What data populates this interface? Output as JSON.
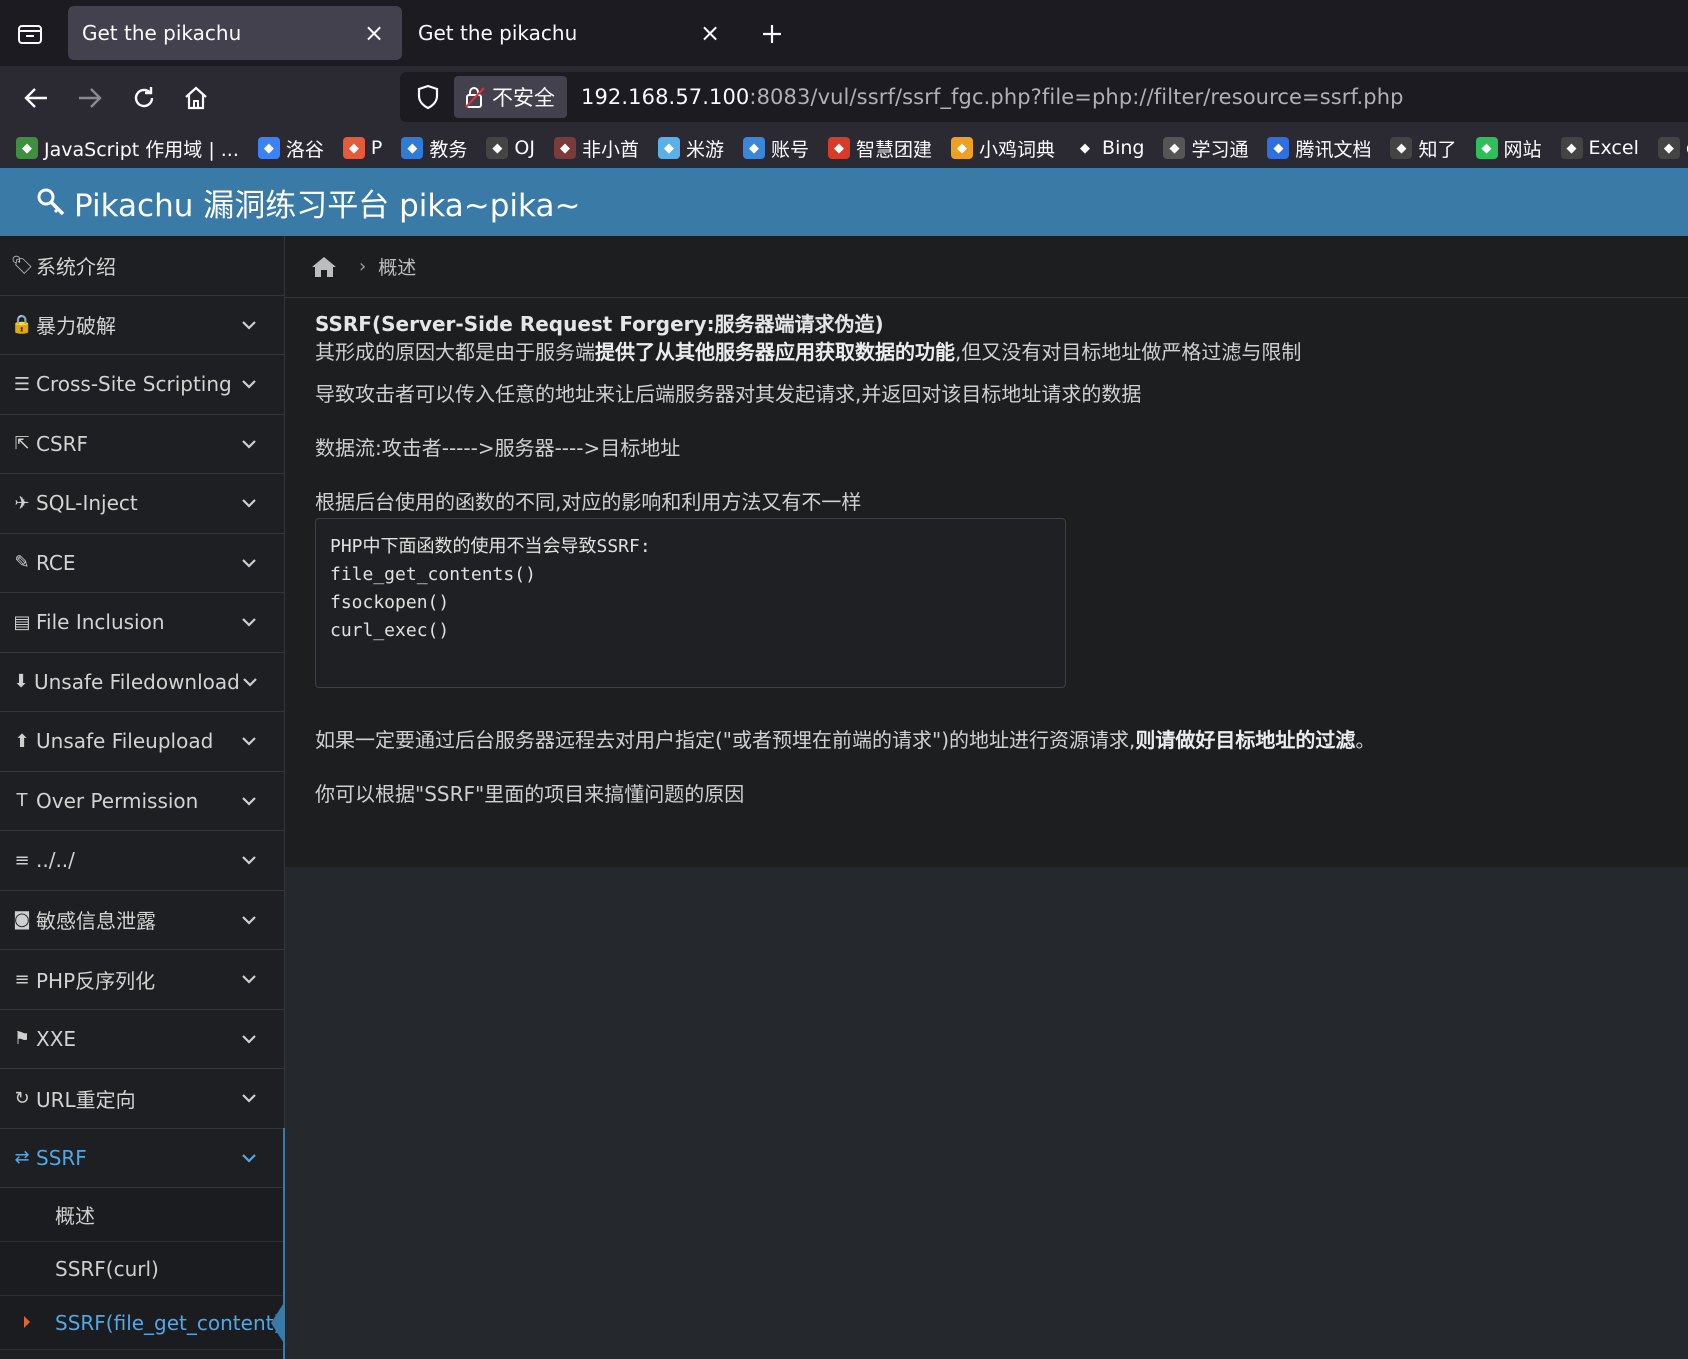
{
  "browser": {
    "tabs": [
      {
        "title": "Get the pikachu",
        "active": true
      },
      {
        "title": "Get the pikachu",
        "active": false
      }
    ],
    "insecure_label": "不安全",
    "url_host": "192.168.57.100",
    "url_rest": ":8083/vul/ssrf/ssrf_fgc.php?file=php://filter/resource=ssrf.php",
    "bookmarks": [
      {
        "label": "JavaScript 作用域 | ...",
        "icon": "js-icon",
        "color": "#3f8f3f"
      },
      {
        "label": "洛谷",
        "icon": "luogu-icon",
        "color": "#3b82f6"
      },
      {
        "label": "P",
        "icon": "p-icon",
        "color": "#e45a3b"
      },
      {
        "label": "教务",
        "icon": "edu-icon",
        "color": "#2f7bd8"
      },
      {
        "label": "OJ",
        "icon": "globe-icon",
        "color": "#444"
      },
      {
        "label": "非小酋",
        "icon": "anime-icon",
        "color": "#7a3b3b"
      },
      {
        "label": "米游",
        "icon": "miyou-icon",
        "color": "#5ab0e8"
      },
      {
        "label": "账号",
        "icon": "mi-icon",
        "color": "#3a86d8"
      },
      {
        "label": "智慧团建",
        "icon": "league-icon",
        "color": "#d83b2a"
      },
      {
        "label": "小鸡词典",
        "icon": "chick-icon",
        "color": "#f0a020"
      },
      {
        "label": "Bing",
        "icon": "search-icon",
        "color": "#2b2a33"
      },
      {
        "label": "学习通",
        "icon": "xxt-icon",
        "color": "#555"
      },
      {
        "label": "腾讯文档",
        "icon": "tencent-doc-icon",
        "color": "#2f6fe0"
      },
      {
        "label": "知了",
        "icon": "globe-icon",
        "color": "#444"
      },
      {
        "label": "网站",
        "icon": "site-icon",
        "color": "#2fbf5a"
      },
      {
        "label": "Excel",
        "icon": "excel-icon",
        "color": "#444"
      },
      {
        "label": "cha",
        "icon": "chatgpt-icon",
        "color": "#444"
      }
    ]
  },
  "header": {
    "brand": "Pikachu 漏洞练习平台 pika~pika~"
  },
  "sidebar": {
    "items": [
      {
        "label": "系统介绍",
        "icon": "tags-icon",
        "glyph": "🏷",
        "expandable": false
      },
      {
        "label": "暴力破解",
        "icon": "lock-icon",
        "glyph": "🔒",
        "expandable": true
      },
      {
        "label": "Cross-Site Scripting",
        "icon": "list-indent-icon",
        "glyph": "☰",
        "expandable": true
      },
      {
        "label": "CSRF",
        "icon": "share-icon",
        "glyph": "⇱",
        "expandable": true
      },
      {
        "label": "SQL-Inject",
        "icon": "plane-icon",
        "glyph": "✈",
        "expandable": true
      },
      {
        "label": "RCE",
        "icon": "pencil-icon",
        "glyph": "✎",
        "expandable": true
      },
      {
        "label": "File Inclusion",
        "icon": "file-icon",
        "glyph": "▤",
        "expandable": true
      },
      {
        "label": "Unsafe Filedownload",
        "icon": "download-circle-icon",
        "glyph": "⬇",
        "expandable": true
      },
      {
        "label": "Unsafe Fileupload",
        "icon": "upload-circle-icon",
        "glyph": "⬆",
        "expandable": true
      },
      {
        "label": "Over Permission",
        "icon": "text-height-icon",
        "glyph": "T",
        "expandable": true
      },
      {
        "label": "../../",
        "icon": "align-left-icon",
        "glyph": "≡",
        "expandable": true
      },
      {
        "label": "敏感信息泄露",
        "icon": "camera-icon",
        "glyph": "◙",
        "expandable": true
      },
      {
        "label": "PHP反序列化",
        "icon": "align-left-icon",
        "glyph": "≡",
        "expandable": true
      },
      {
        "label": "XXE",
        "icon": "flag-icon",
        "glyph": "⚑",
        "expandable": true
      },
      {
        "label": "URL重定向",
        "icon": "refresh-icon",
        "glyph": "↻",
        "expandable": true
      },
      {
        "label": "SSRF",
        "icon": "exchange-icon",
        "glyph": "⇄",
        "expandable": true,
        "active": true
      }
    ],
    "ssrf_sub": [
      {
        "label": "概述"
      },
      {
        "label": "SSRF(curl)"
      },
      {
        "label": "SSRF(file_get_content)",
        "active": true
      }
    ]
  },
  "main": {
    "breadcrumb": "概述",
    "title": "SSRF(Server-Side Request Forgery:服务器端请求伪造)",
    "p1_a": "其形成的原因大都是由于服务端",
    "p1_b": "提供了从其他服务器应用获取数据的功能",
    "p1_c": ",但又没有对目标地址做严格过滤与限制",
    "p2": "导致攻击者可以传入任意的地址来让后端服务器对其发起请求,并返回对该目标地址请求的数据",
    "p3": "数据流:攻击者----->服务器---->目标地址",
    "p4": "根据后台使用的函数的不同,对应的影响和利用方法又有不一样",
    "code_lines": [
      "PHP中下面函数的使用不当会导致SSRF:",
      "file_get_contents()",
      "fsockopen()",
      "curl_exec()"
    ],
    "p5_a": "如果一定要通过后台服务器远程去对用户指定(\"或者预埋在前端的请求\")的地址进行资源请求,",
    "p5_b": "则请做好目标地址的过滤",
    "p5_c": "。",
    "p6": "你可以根据\"SSRF\"里面的项目来搞懂问题的原因"
  },
  "colors": {
    "header_blue": "#3a7aa6",
    "active_blue": "#4fa8e8",
    "caret_orange": "#e0633a"
  }
}
